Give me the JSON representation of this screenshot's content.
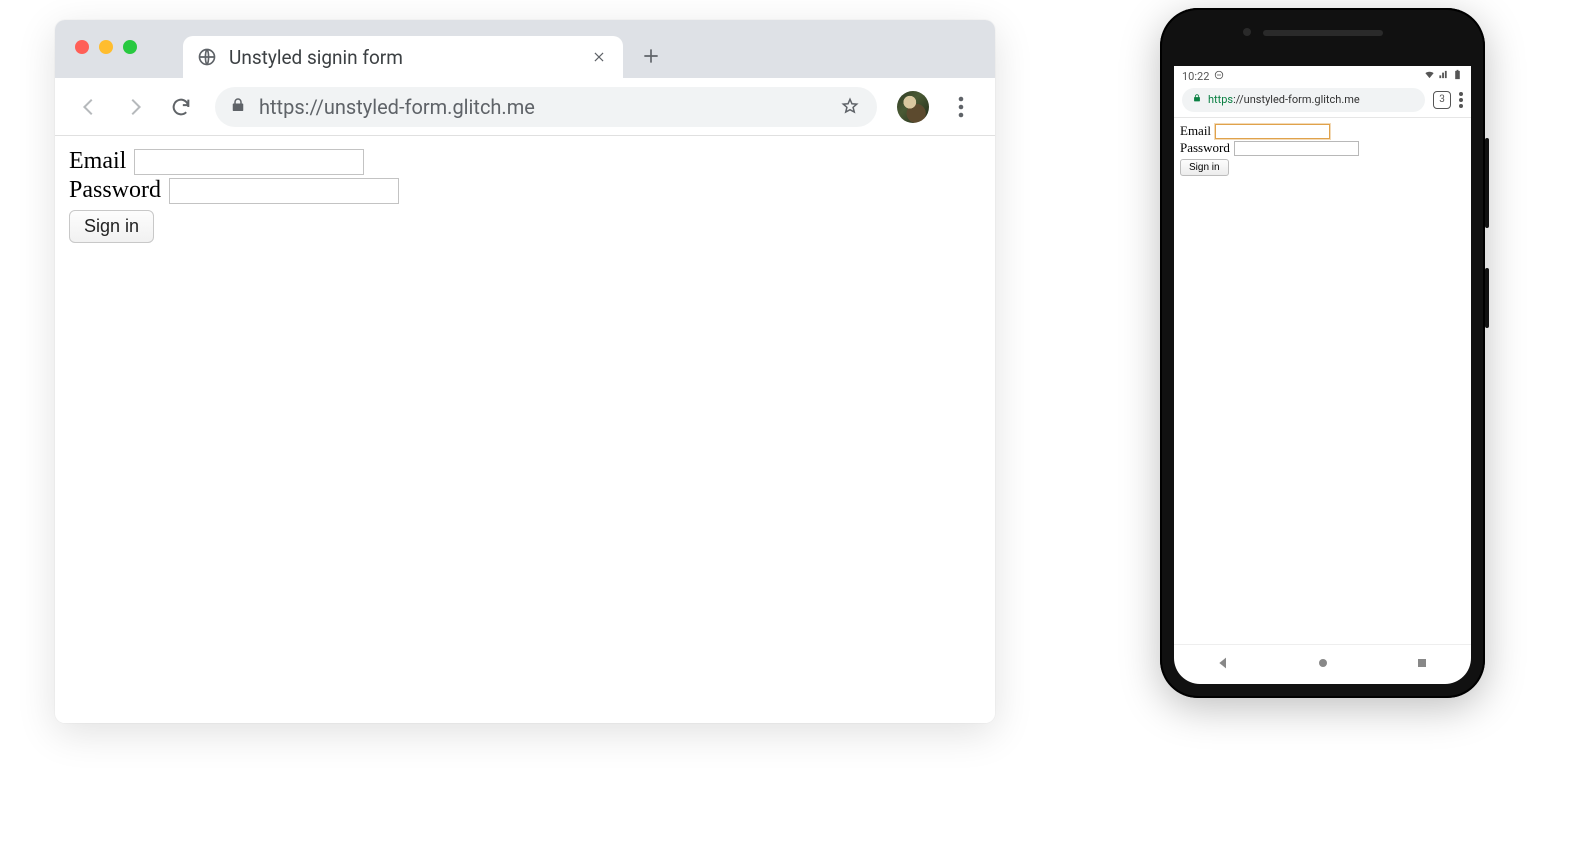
{
  "desktop": {
    "tab_title": "Unstyled signin form",
    "url": "https://unstyled-form.glitch.me",
    "form": {
      "email_label": "Email",
      "password_label": "Password",
      "submit_label": "Sign in"
    }
  },
  "mobile": {
    "status": {
      "time": "10:22",
      "tab_count": "3"
    },
    "url_https": "https",
    "url_rest": "://unstyled-form.glitch.me",
    "form": {
      "email_label": "Email",
      "password_label": "Password",
      "submit_label": "Sign in"
    }
  }
}
